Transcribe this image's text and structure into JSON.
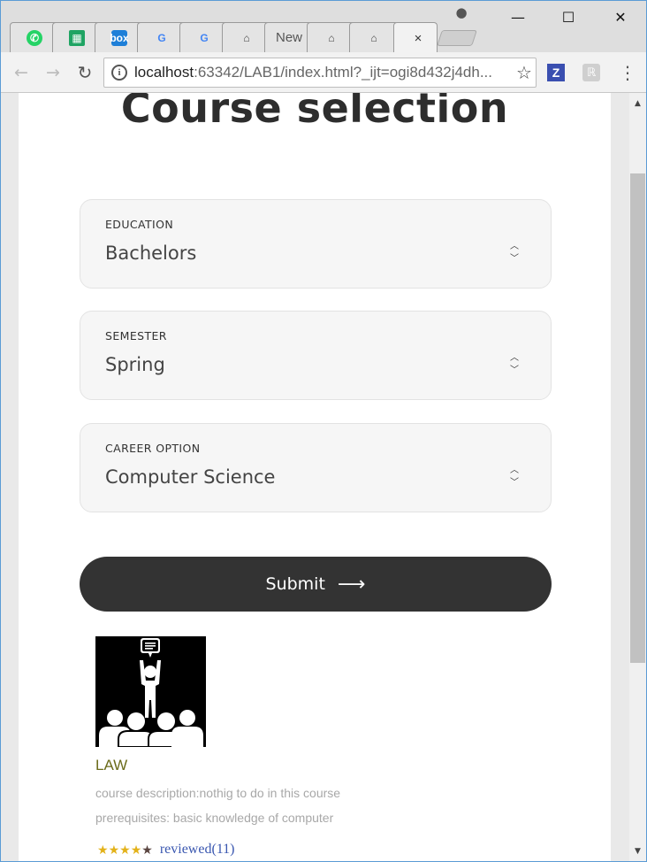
{
  "browser": {
    "tabs": [
      {
        "icon": "whatsapp-icon",
        "label": ""
      },
      {
        "icon": "sheets-icon",
        "label": ""
      },
      {
        "icon": "box-icon",
        "label": "box"
      },
      {
        "icon": "google-icon",
        "label": "G"
      },
      {
        "icon": "google-icon",
        "label": "G"
      },
      {
        "icon": "home-icon",
        "label": ""
      },
      {
        "icon": "",
        "label": "New"
      },
      {
        "icon": "home-icon",
        "label": ""
      },
      {
        "icon": "home-icon",
        "label": ""
      }
    ],
    "active_tab_close": "×",
    "window_controls": {
      "minimize": "—",
      "maximize": "☐",
      "close": "✕"
    },
    "url_host": "localhost",
    "url_rest": ":63342/LAB1/index.html?_ijt=ogi8d432j4dh..."
  },
  "page": {
    "title": "Course selection",
    "fields": [
      {
        "label": "EDUCATION",
        "value": "Bachelors"
      },
      {
        "label": "SEMESTER",
        "value": "Spring"
      },
      {
        "label": "CAREER OPTION",
        "value": "Computer Science"
      }
    ],
    "submit_label": "Submit",
    "submit_arrow": "⟶",
    "course": {
      "name": "LAW",
      "description": "course description:nothig to do in this course",
      "prerequisites": "prerequisites: basic knowledge of computer",
      "rating_stars": 4,
      "rating_max": 5,
      "reviewed_text": "reviewed(11)"
    }
  },
  "colors": {
    "title": "#2d2d2d",
    "button_bg": "#333333",
    "course_name": "#6b6b1a",
    "link": "#3a57b0"
  }
}
